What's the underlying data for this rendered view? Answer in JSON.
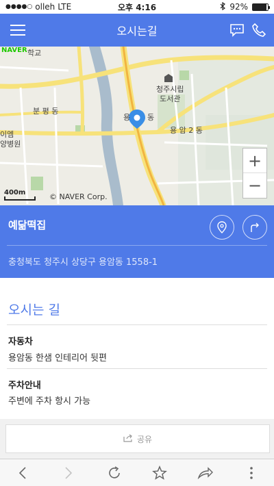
{
  "status_bar": {
    "carrier": "olleh",
    "network": "LTE",
    "time": "오후 4:16",
    "battery": "92%",
    "battery_level": 0.92
  },
  "header": {
    "title": "오시는길",
    "menu_icon": "hamburger-icon",
    "chat_icon": "chat-icon",
    "phone_icon": "phone-icon"
  },
  "map": {
    "provider_logo": "NAVER",
    "labels": {
      "school": "학교",
      "cityhall_lib_1": "청주시립",
      "cityhall_lib_2": "도서관",
      "bunpyeong": "분 평 동",
      "yongam": "용",
      "yongam_dong": "동",
      "yongam2": "용 암 2 동",
      "left_top": "이엠",
      "left_bottom": "양병원"
    },
    "scale": "400m",
    "copyright": "© NAVER Corp.",
    "zoom_in": "+",
    "zoom_out": "−"
  },
  "place": {
    "name": "예닮떡집",
    "address": "충청북도 청주시 상당구 용암동 1558-1",
    "location_icon": "map-pin-icon",
    "route_icon": "route-arrow-icon"
  },
  "directions": {
    "heading": "오시는 길",
    "sections": [
      {
        "title": "자동차",
        "text": "용암동 한샘 인테리어 뒷편"
      },
      {
        "title": "주차안내",
        "text": "주변에 주차 항시 가능"
      }
    ]
  },
  "share": {
    "label": "공유",
    "icon": "share-icon"
  },
  "toolbar": {
    "items": [
      "back-icon",
      "forward-icon",
      "refresh-icon",
      "bookmark-star-icon",
      "share-arrow-icon",
      "more-icon"
    ]
  }
}
